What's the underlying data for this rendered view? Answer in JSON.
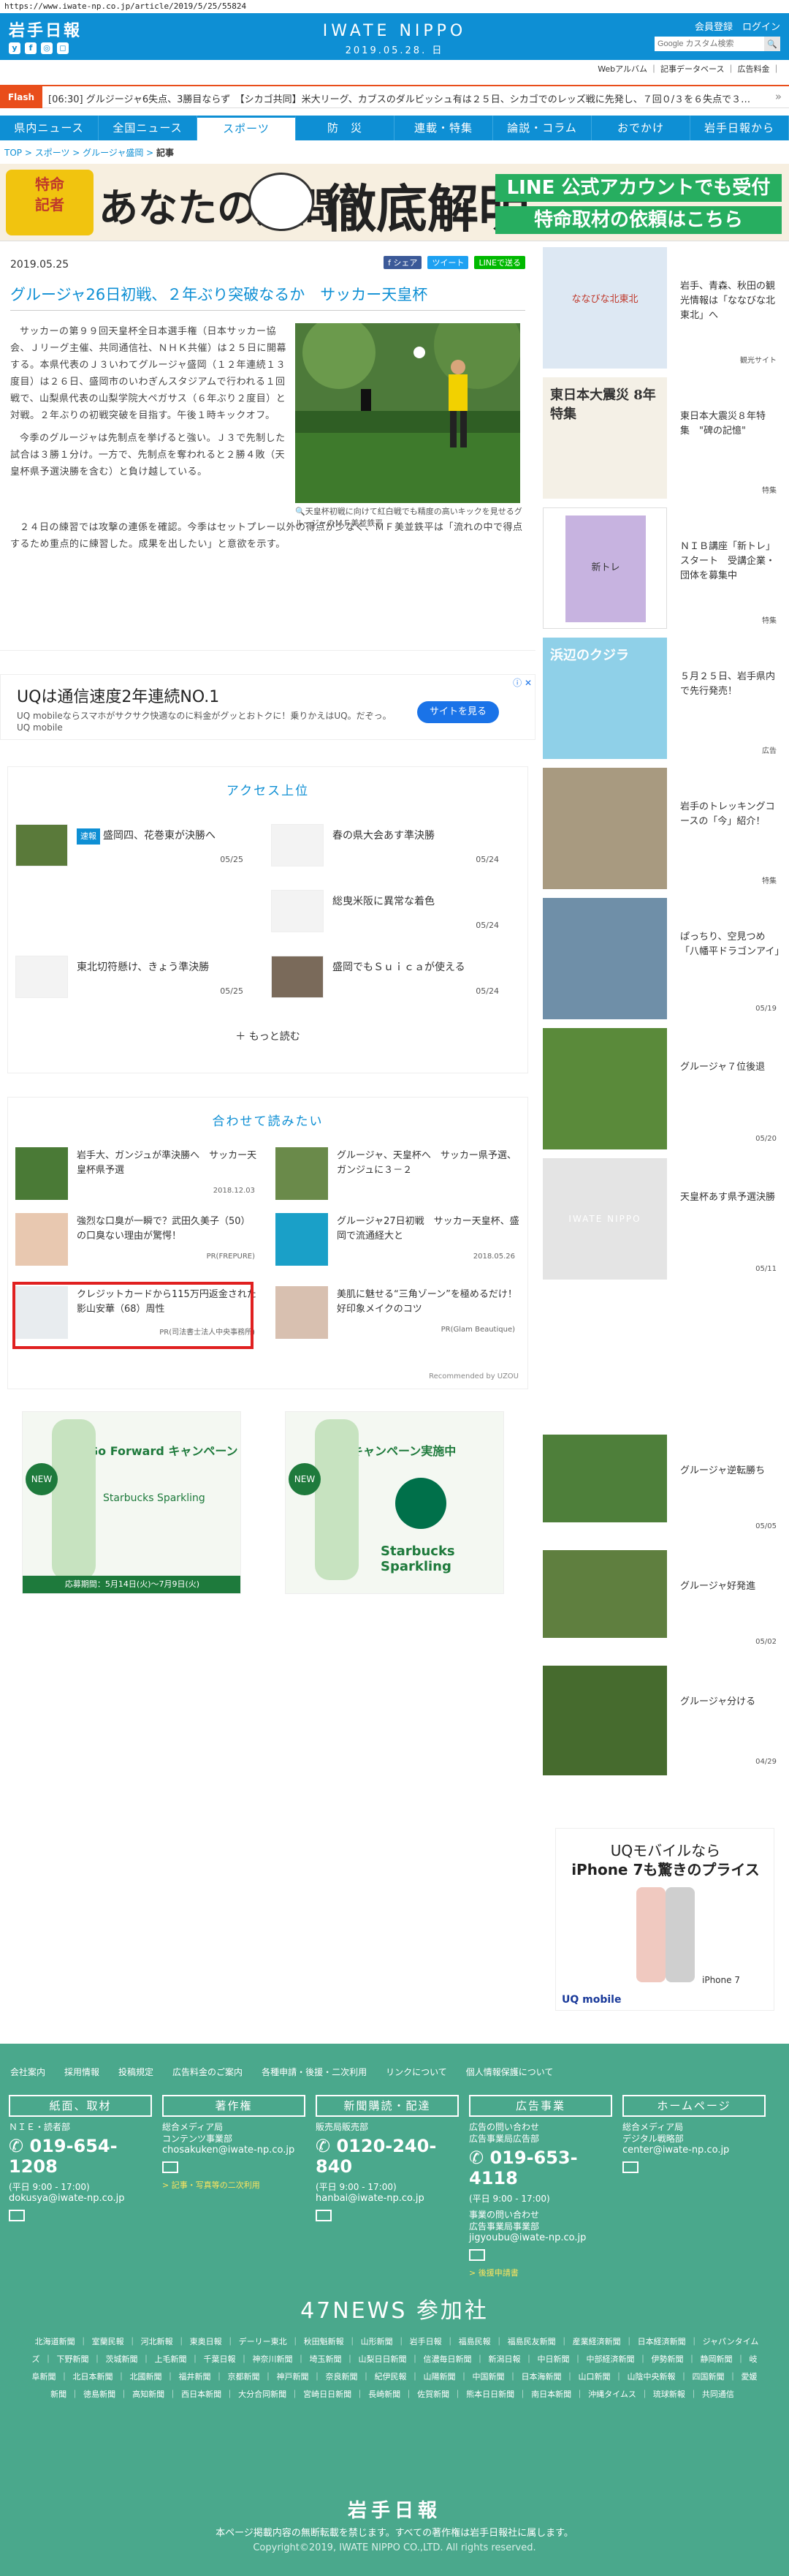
{
  "url": "https://www.iwate-np.co.jp/article/2019/5/25/55824",
  "header": {
    "logo": "岩手日報",
    "brand": "IWATE NIPPO",
    "date": "2019.05.28. 日",
    "member_links": "会員登録　ログイン",
    "search_placeholder": "Google カスタム検索",
    "search_btn": "🔍",
    "util_links": "Webアルバム ｜ 記事データベース ｜ 広告料金 ｜",
    "social": [
      "y",
      "f",
      "◎",
      "◻"
    ]
  },
  "flash": {
    "label": "Flash",
    "text": "[06:30] グルジージャ6失点、3勝目ならず　【シカゴ共同】米大リーグ、カブスのダルビッシュ有は２５日、シカゴでのレッズ戦に先発し、７回０/３を６失点で３…",
    "arrow": "»"
  },
  "nav": [
    "県内ニュース",
    "全国ニュース",
    "スポーツ",
    "防　災",
    "連載・特集",
    "論説・コラム",
    "おでかけ",
    "岩手日報から"
  ],
  "breadcrumb": {
    "items": [
      "TOP",
      "スポーツ",
      "グルージャ盛岡"
    ],
    "current": "記事"
  },
  "banner": {
    "b1": "特命記者\nあなたの疑問",
    "b2": "あなたの疑問",
    "b4": "徹底解明",
    "b5": "LINE 公式アカウントでも受付",
    "b6": "特命取材の依頼はこちら"
  },
  "article": {
    "date": "2019.05.25",
    "share": [
      "f シェア",
      "ツイート",
      "LINEで送る"
    ],
    "title": "グルージャ26日初戦、２年ぶり突破なるか　サッカー天皇杯",
    "p1": "サッカーの第９９回天皇杯全日本選手権（日本サッカー協会、Ｊリーグ主催、共同通信社、ＮＨＫ共催）は２５日に開幕する。本県代表のＪ３いわてグルージャ盛岡（１２年連続１３度目）は２６日、盛岡市のいわぎんスタジアムで行われる１回戦で、山梨県代表の山梨学院大ペガサス（６年ぶり２度目）と対戦。２年ぶりの初戦突破を目指す。午後１時キックオフ。",
    "p2": "今季のグルージャは先制点を挙げると強い。Ｊ３で先制した試合は３勝１分け。一方で、先制点を奪われると２勝４敗（天皇杯県予選決勝を含む）と負け越している。",
    "p3": "２４日の練習では攻撃の連係を確認。今季はセットプレー以外の得点が少なく、ＭＦ美並鉄平は「流れの中で得点するため重点的に練習した。成果を出したい」と意欲を示す。",
    "caption": "天皇杯初戦に向けて紅白戦でも精度の高いキックを見せるグルージャのＭＦ美並鉄平"
  },
  "uq_ad": {
    "headline": "UQは通信速度2年連続NO.1",
    "desc": "UQ mobileならスマホがサクサク快適なのに料金がグッとおトクに！乗りかえはUQ。だぞっ。UQ mobile",
    "button": "サイトを見る",
    "close": "ⓘ ✕"
  },
  "access": {
    "heading": "アクセス上位",
    "items": [
      {
        "tag": "速報",
        "title": "盛岡四、花巻東が決勝へ",
        "date": "05/25"
      },
      {
        "title": "春の県大会あす準決勝",
        "date": "05/24"
      },
      {
        "title": "総曳米阪に異常な着色",
        "date": "05/24"
      },
      {
        "title": "東北切符懸け、きょう準決勝",
        "date": "05/25"
      },
      {
        "title": "盛岡でもＳｕｉｃａが使える",
        "date": "05/24"
      }
    ],
    "more": "もっと読む"
  },
  "recommend": {
    "heading": "合わせて読みたい",
    "items": [
      {
        "title": "岩手大、ガンジュが準決勝へ　サッカー天皇杯県予選",
        "date": "2018.12.03"
      },
      {
        "title": "グルージャ、天皇杯へ　サッカー県予選、ガンジュに３－２",
        "date": ""
      },
      {
        "title": "強烈な口臭が一瞬で？武田久美子（50）の口臭ない理由が驚愕！",
        "date": "PR(FREPURE)"
      },
      {
        "title": "グルージャ27日初戦　サッカー天皇杯、盛岡で流通経大と",
        "date": "2018.05.26"
      },
      {
        "title": "クレジットカードから115万円返金された影山安華（68）周性",
        "date": "PR(司法書士法人中央事務所)"
      },
      {
        "title": "美肌に魅せる“三角ゾーン”を極めるだけ！好印象メイクのコツ",
        "date": "PR(Glam Beautique)"
      }
    ],
    "powered": "Recommended by UZOU"
  },
  "ads2": [
    {
      "head": "Go Forward キャンペーン",
      "sub": "応募期間：5月14日(火)〜7月9日(火)",
      "prod": "Starbucks Sparkling"
    },
    {
      "head": "キャンペーン実施中",
      "prod": "Starbucks Sparkling"
    }
  ],
  "side": [
    {
      "title": "岩手、青森、秋田の観光情報は「ななびな北東北」へ",
      "cap": "観光サイト",
      "th": "ななびな北東北"
    },
    {
      "title": "東日本大震災８年特集　\"碑の記憶\"",
      "cap": "特集",
      "th": "東日本大震災 8年特集"
    },
    {
      "title": "ＮＩＢ講座「新トレ」スタート　受講企業・団体を募集中",
      "cap": "特集",
      "th": "新トレ"
    },
    {
      "title": "５月２５日、岩手県内で先行発売！",
      "cap": "広告",
      "th": "浜辺のクジラ"
    },
    {
      "title": "岩手のトレッキングコースの「今」紹介！",
      "cap": "特集",
      "th": ""
    },
    {
      "title": "ぱっちり、空見つめ「八幡平ドラゴンアイ」",
      "cap": "05/19",
      "th": ""
    },
    {
      "title": "グルージャ７位後退",
      "cap": "05/20",
      "th": ""
    },
    {
      "title": "天皇杯あす県予選決勝",
      "cap": "05/11",
      "th": "IWATE NIPPO"
    },
    {
      "title": "グルージャ逆転勝ち",
      "cap": "05/05",
      "th": ""
    },
    {
      "title": "グルージャ好発進",
      "cap": "05/02",
      "th": ""
    },
    {
      "title": "グルージャ分ける",
      "cap": "04/29",
      "th": ""
    }
  ],
  "side_ad": {
    "line1": "UQモバイルなら",
    "line2": "iPhone 7も驚きのプライス",
    "prod": "iPhone 7",
    "brand": "UQ mobile"
  },
  "footer": {
    "links": [
      "会社案内",
      "採用情報",
      "投稿規定",
      "広告料金のご案内",
      "各種申請・後援・二次利用",
      "リンクについて",
      "個人情報保護について"
    ],
    "cols": [
      {
        "h": "紙面、取材",
        "name": "ＮＩＥ・読者部",
        "tel": "019-654-1208",
        "hours": "(平日 9:00 - 17:00)",
        "mail": "dokusya@iwate-np.co.jp"
      },
      {
        "h": "著作権",
        "name": "総合メディア局\nコンテンツ事業部",
        "mail": "chosakuken@iwate-np.co.jp",
        "link": "> 記事・写真等の二次利用"
      },
      {
        "h": "新聞購読・配達",
        "name": "販売局販売部",
        "tel": "0120-240-840",
        "hours": "(平日 9:00 - 17:00)",
        "mail": "hanbai@iwate-np.co.jp"
      },
      {
        "h": "広告事業",
        "name": "広告の問い合わせ\n広告事業局広告部",
        "tel": "019-653-4118",
        "hours": "(平日 9:00 - 17:00)",
        "name2": "事業の問い合わせ\n広告事業局事業部",
        "mail": "jigyoubu@iwate-np.co.jp",
        "link": "> 後援申請書"
      },
      {
        "h": "ホームページ",
        "name": "総合メディア局\nデジタル戦略部",
        "mail": "center@iwate-np.co.jp"
      }
    ],
    "n47": "47NEWS 参加社",
    "n47links": [
      "北海道新聞",
      "室蘭民報",
      "河北新報",
      "東奥日報",
      "デーリー東北",
      "秋田魁新報",
      "山形新聞",
      "岩手日報",
      "福島民報",
      "福島民友新聞",
      "産業経済新聞",
      "日本経済新聞",
      "ジャパンタイムズ",
      "下野新聞",
      "茨城新聞",
      "上毛新聞",
      "千葉日報",
      "神奈川新聞",
      "埼玉新聞",
      "山梨日日新聞",
      "信濃毎日新聞",
      "新潟日報",
      "中日新聞",
      "中部経済新聞",
      "伊勢新聞",
      "静岡新聞",
      "岐阜新聞",
      "北日本新聞",
      "北國新聞",
      "福井新聞",
      "京都新聞",
      "神戸新聞",
      "奈良新聞",
      "紀伊民報",
      "山陽新聞",
      "中国新聞",
      "日本海新聞",
      "山口新聞",
      "山陰中央新報",
      "四国新聞",
      "愛媛新聞",
      "徳島新聞",
      "高知新聞",
      "西日本新聞",
      "大分合同新聞",
      "宮崎日日新聞",
      "長崎新聞",
      "佐賀新聞",
      "熊本日日新聞",
      "南日本新聞",
      "沖縄タイムス",
      "琉球新報",
      "共同通信"
    ],
    "logo": "岩手日報",
    "copy1": "本ページ掲載内容の無断転載を禁じます。すべての著作権は岩手日報社に属します。",
    "copy2": "Copyright©2019, IWATE NIPPO CO.,LTD. All rights reserved."
  },
  "colors": {
    "brand": "#0e8fd4",
    "flash": "#e94e1b",
    "footer": "#4aa88c"
  }
}
